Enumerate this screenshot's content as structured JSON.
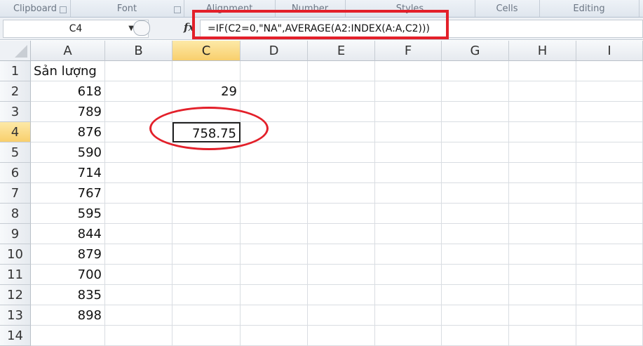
{
  "ribbon": {
    "groups": [
      "Clipboard",
      "Font",
      "Alignment",
      "Number",
      "Styles",
      "Cells",
      "Editing"
    ]
  },
  "formula_bar": {
    "name_box": "C4",
    "fx": "fx",
    "formula": "=IF(C2=0,\"NA\",AVERAGE(A2:INDEX(A:A,C2)))"
  },
  "columns": [
    "A",
    "B",
    "C",
    "D",
    "E",
    "F",
    "G",
    "H",
    "I"
  ],
  "selected_column": "C",
  "rows": [
    "1",
    "2",
    "3",
    "4",
    "5",
    "6",
    "7",
    "8",
    "9",
    "10",
    "11",
    "12",
    "13",
    "14"
  ],
  "selected_row": "4",
  "cells": {
    "A1": "Sản lượng",
    "A2": "618",
    "A3": "789",
    "A4": "876",
    "A5": "590",
    "A6": "714",
    "A7": "767",
    "A8": "595",
    "A9": "844",
    "A10": "879",
    "A11": "700",
    "A12": "835",
    "A13": "898",
    "C2": "29",
    "C4": "758.75"
  },
  "colors": {
    "highlight": "#e3202a",
    "selected_header": "#f8cf6c"
  }
}
